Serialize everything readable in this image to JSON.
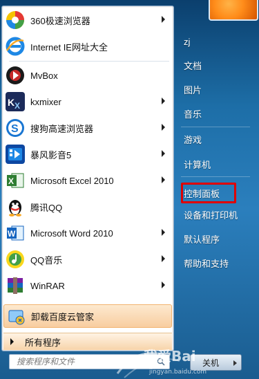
{
  "programs": [
    {
      "label": "360极速浏览器",
      "icon": "browser-360-icon",
      "has_submenu": true
    },
    {
      "label": "Internet IE网址大全",
      "icon": "internet-explorer-icon",
      "has_submenu": false
    },
    {
      "label": "MvBox",
      "icon": "mvbox-icon",
      "has_submenu": false
    },
    {
      "label": "kxmixer",
      "icon": "kxmixer-icon",
      "has_submenu": true
    },
    {
      "label": "搜狗高速浏览器",
      "icon": "sogou-browser-icon",
      "has_submenu": true
    },
    {
      "label": "暴风影音5",
      "icon": "baofeng-player-icon",
      "has_submenu": true
    },
    {
      "label": "Microsoft Excel 2010",
      "icon": "excel-icon",
      "has_submenu": true
    },
    {
      "label": "腾讯QQ",
      "icon": "qq-penguin-icon",
      "has_submenu": false
    },
    {
      "label": "Microsoft Word 2010",
      "icon": "word-icon",
      "has_submenu": true
    },
    {
      "label": "QQ音乐",
      "icon": "qq-music-icon",
      "has_submenu": true
    },
    {
      "label": "WinRAR",
      "icon": "winrar-icon",
      "has_submenu": true
    }
  ],
  "highlighted": {
    "label": "卸载百度云管家",
    "icon": "uninstall-icon"
  },
  "all_programs_label": "所有程序",
  "search": {
    "placeholder": "搜索程序和文件"
  },
  "right_panel": {
    "items": [
      "zj",
      "文档",
      "图片",
      "音乐",
      "游戏",
      "计算机",
      "控制面板",
      "设备和打印机",
      "默认程序",
      "帮助和支持"
    ],
    "highlight_box_item": "控制面板",
    "highlight_color": "#e00000"
  },
  "shutdown_label": "关机",
  "watermark": {
    "text": "我爱Bai",
    "url": "jingyan.baidu.com"
  }
}
